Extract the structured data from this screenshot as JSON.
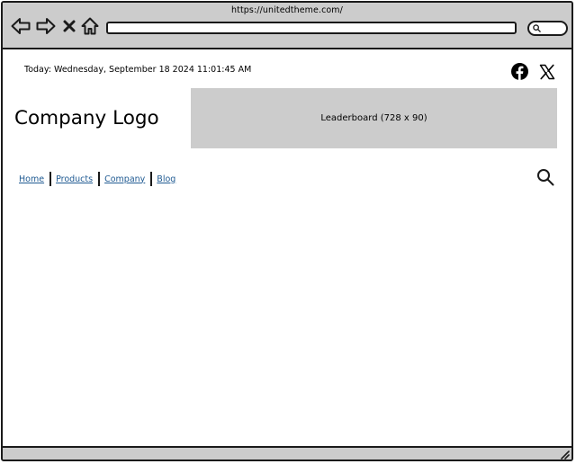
{
  "browser": {
    "url": "https://unitedtheme.com/",
    "icons": {
      "back": "arrow-left-icon",
      "forward": "arrow-right-icon",
      "stop": "close-icon",
      "home": "home-icon",
      "search": "search-icon"
    }
  },
  "header": {
    "date_text": "Today: Wednesday, September 18 2024  11:01:45 AM",
    "social": [
      {
        "name": "facebook",
        "icon": "facebook-icon"
      },
      {
        "name": "x",
        "icon": "x-logo-icon"
      }
    ],
    "logo_text": "Company Logo",
    "leaderboard_text": "Leaderboard (728 x 90)"
  },
  "nav": {
    "items": [
      {
        "label": "Home"
      },
      {
        "label": "Products"
      },
      {
        "label": "Company"
      },
      {
        "label": "Blog"
      }
    ],
    "search_icon": "search-icon"
  },
  "colors": {
    "chrome": "#cccccc",
    "link": "#1f5a92",
    "placeholder": "#cccccc",
    "border": "#1a1a1a"
  }
}
